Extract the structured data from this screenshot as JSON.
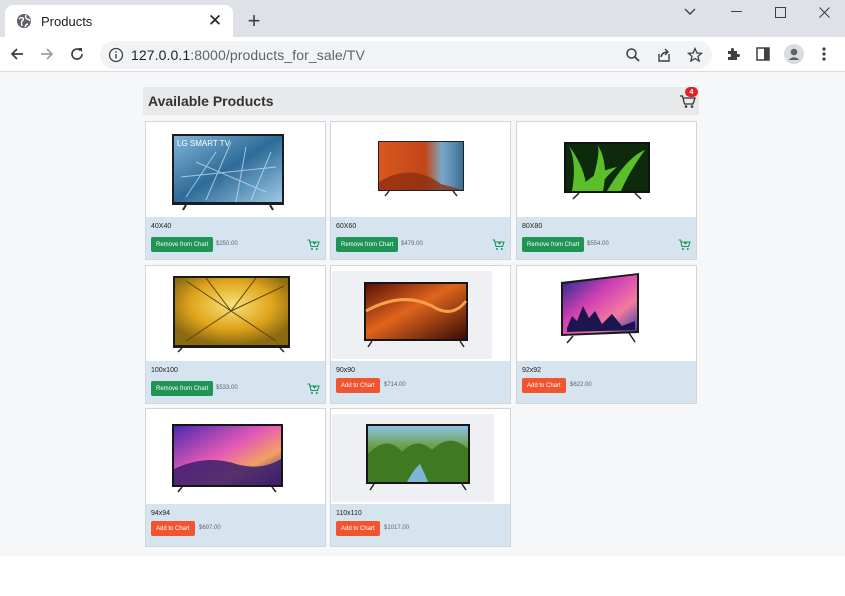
{
  "browser": {
    "tab_title": "Products",
    "tab_close": "✕",
    "new_tab": "+",
    "url_host": "127.0.0.1",
    "url_rest": ":8000/products_for_sale/TV",
    "window_minimize": "—",
    "window_maximize": "☐",
    "window_close": "✕",
    "window_tabs_chevron": "⌄"
  },
  "page": {
    "title": "Available Products",
    "cart_count": "4"
  },
  "products": [
    {
      "size": "40X40",
      "button": "Remove from Chart",
      "price": "$250.00",
      "in_cart": true,
      "screen": "lg-blue"
    },
    {
      "size": "60X60",
      "button": "Remove from Chart",
      "price": "$479.00",
      "in_cart": true,
      "screen": "orange-valley"
    },
    {
      "size": "80X80",
      "button": "Remove from Chart",
      "price": "$554.00",
      "in_cart": true,
      "screen": "green-leaves"
    },
    {
      "size": "100x100",
      "button": "Remove from Chart",
      "price": "$533.00",
      "in_cart": true,
      "screen": "yellow-trees"
    },
    {
      "size": "90x90",
      "button": "Add to Chart",
      "price": "$714.00",
      "in_cart": false,
      "screen": "red-canyon"
    },
    {
      "size": "92x92",
      "button": "Add to Chart",
      "price": "$622.00",
      "in_cart": false,
      "screen": "purple-city"
    },
    {
      "size": "94x94",
      "button": "Add to Chart",
      "price": "$697.00",
      "in_cart": false,
      "screen": "pink-sunset"
    },
    {
      "size": "110x110",
      "button": "Add to Chart",
      "price": "$1017.00",
      "in_cart": false,
      "screen": "green-valley"
    }
  ],
  "tv_logo_text": "LG SMART TV",
  "colors": {
    "remove_button": "#1f9454",
    "add_button": "#f0552f",
    "card_footer": "#d6e4ef",
    "badge": "#e02424",
    "cart_icon_green": "#1f9454"
  }
}
